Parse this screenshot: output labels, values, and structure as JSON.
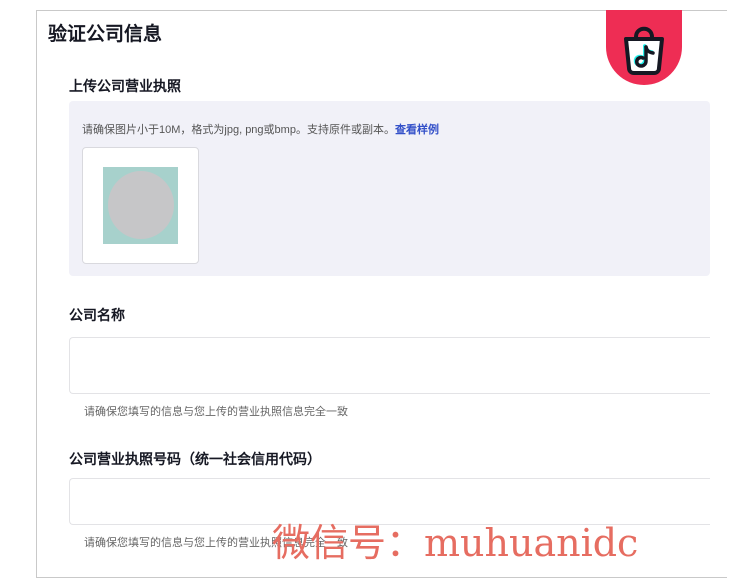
{
  "header": {
    "title": "验证公司信息",
    "logo_icon": "tiktok-shop-bag-icon",
    "logo_color": "#ee2d54"
  },
  "license_upload": {
    "title": "上传公司营业执照",
    "hint": "请确保图片小于10M，格式为jpg, png或bmp。支持原件或副本。",
    "sample_link": "查看样例"
  },
  "company_name": {
    "label": "公司名称",
    "placeholder": "",
    "value": "",
    "helper": "请确保您填写的信息与您上传的营业执照信息完全一致"
  },
  "license_number": {
    "label": "公司营业执照号码（统一社会信用代码）",
    "placeholder": "",
    "value": "",
    "helper": "请确保您填写的信息与您上传的营业执照信息完全一致"
  },
  "watermark": "微信号：muhuanidc",
  "colors": {
    "accent_link": "#3451c9",
    "panel_bg": "#f1f1f8",
    "watermark": "#e66d61"
  }
}
